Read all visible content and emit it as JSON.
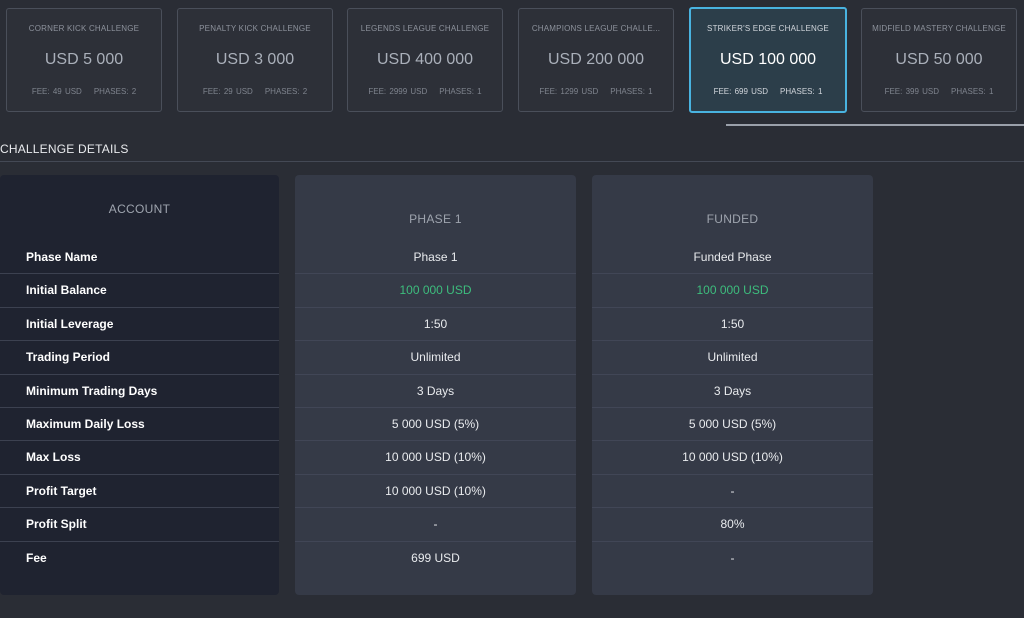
{
  "challenges": [
    {
      "name": "CORNER KICK CHALLENGE",
      "amount": "USD 5 000",
      "fee": "FEE: 49 USD",
      "phases": "PHASES: 2"
    },
    {
      "name": "PENALTY KICK CHALLENGE",
      "amount": "USD 3 000",
      "fee": "FEE: 29 USD",
      "phases": "PHASES: 2"
    },
    {
      "name": "LEGENDS LEAGUE CHALLENGE",
      "amount": "USD 400 000",
      "fee": "FEE: 2999 USD",
      "phases": "PHASES: 1"
    },
    {
      "name": "CHAMPIONS LEAGUE CHALLE...",
      "amount": "USD 200 000",
      "fee": "FEE: 1299 USD",
      "phases": "PHASES: 1"
    },
    {
      "name": "STRIKER'S EDGE CHALLENGE",
      "amount": "USD 100 000",
      "fee": "FEE: 699 USD",
      "phases": "PHASES: 1"
    },
    {
      "name": "MIDFIELD MASTERY CHALLENGE",
      "amount": "USD 50 000",
      "fee": "FEE: 399 USD",
      "phases": "PHASES: 1"
    }
  ],
  "section": {
    "title": "CHALLENGE DETAILS"
  },
  "account": {
    "header": "ACCOUNT",
    "labels": [
      "Phase Name",
      "Initial Balance",
      "Initial Leverage",
      "Trading Period",
      "Minimum Trading Days",
      "Maximum Daily Loss",
      "Max Loss",
      "Profit Target",
      "Profit Split",
      "Fee"
    ]
  },
  "phase1": {
    "header": "PHASE 1",
    "values": [
      "Phase 1",
      "100 000 USD",
      "1:50",
      "Unlimited",
      "3 Days",
      "5 000 USD (5%)",
      "10 000 USD (10%)",
      "10 000 USD (10%)",
      "-",
      "699 USD"
    ]
  },
  "funded": {
    "header": "FUNDED",
    "values": [
      "Funded Phase",
      "100 000 USD",
      "1:50",
      "Unlimited",
      "3 Days",
      "5 000 USD (5%)",
      "10 000 USD (10%)",
      "-",
      "80%",
      "-"
    ]
  },
  "colors": {
    "accent": "#49b3e0",
    "positive": "#3dbd7d"
  }
}
